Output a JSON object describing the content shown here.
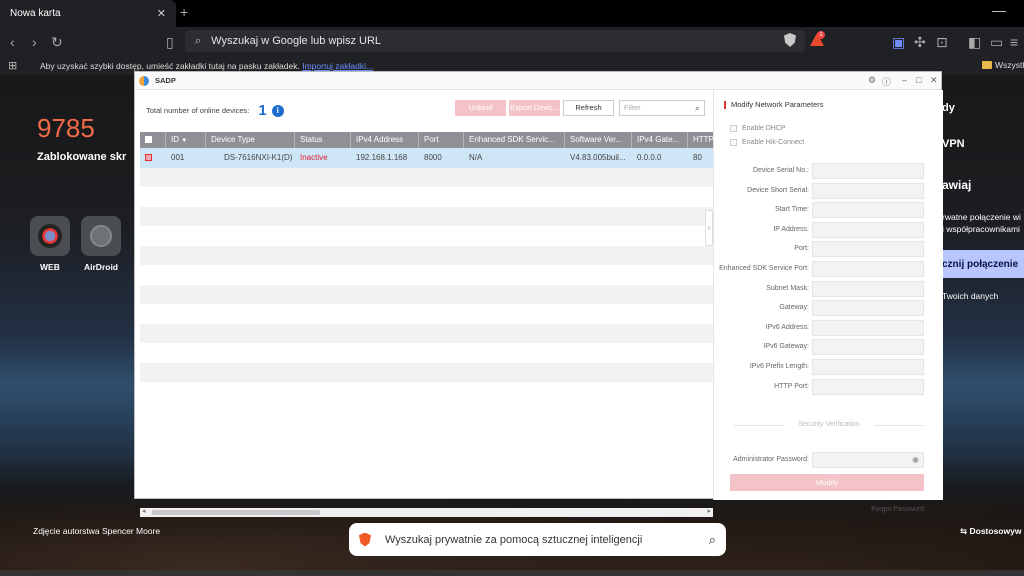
{
  "browser": {
    "tab_title": "Nowa karta",
    "tab_close": "✕",
    "new_tab": "+",
    "address_placeholder": "Wyszukaj w Google lub wpisz URL",
    "brave_badge": "1",
    "bookmarks_hint": "Aby uzyskać szybki dostęp, umieść zakładki tutaj na pasku zakładek.",
    "bookmarks_import": "Importuj zakładki...",
    "bookmarks_folder": "Wszystk"
  },
  "newtab": {
    "counter": "9785",
    "counter_label": "Zablokowane skr",
    "shortcuts": [
      {
        "label": "WEB"
      },
      {
        "label": "AirDroid"
      }
    ],
    "right_fragments": {
      "dy": "dy",
      "vpn": "VPN",
      "awiaj": "awiaj",
      "line1": "rwatne połączenie wi",
      "line2": "i współpracownikami",
      "connect": "cznij połączenie",
      "data": "Twoich danych"
    },
    "photo_credit": "Zdjęcie autorstwa Spencer Moore",
    "customize": "Dostosowyw",
    "ai_search_placeholder": "Wyszukaj prywatnie za pomocą sztucznej inteligencji"
  },
  "sadp": {
    "title": "SADP",
    "online_label": "Total number of online devices:",
    "online_count": "1",
    "buttons": {
      "unbind": "Unbind",
      "export": "Export Devic...",
      "refresh": "Refresh"
    },
    "filter_placeholder": "Filter",
    "columns": [
      "ID",
      "Device Type",
      "Status",
      "IPv4 Address",
      "Port",
      "Enhanced SDK Servic...",
      "Software Ver...",
      "IPv4 Gate...",
      "HTTP"
    ],
    "devices": [
      {
        "id": "001",
        "device_type": "DS-7616NXI-K1(D)",
        "status": "Inactive",
        "ipv4": "192.168.1.168",
        "port": "8000",
        "sdk": "N/A",
        "software": "V4.83.005buil...",
        "gateway": "0.0.0.0",
        "http": "80"
      }
    ],
    "empty_rows": 12,
    "modify": {
      "title": "Modify Network Parameters",
      "enable_dhcp": "Enable DHCP",
      "enable_hik": "Enable Hik-Connect",
      "fields": [
        "Device Serial No.:",
        "Device Short Serial:",
        "Start Time:",
        "IP Address:",
        "Port:",
        "Enhanced SDK Service Port:",
        "Subnet Mask:",
        "Gateway:",
        "IPv6 Address:",
        "IPv6 Gateway:",
        "IPv6 Prefix Length:",
        "HTTP Port:"
      ],
      "security_verification": "Security Verification",
      "admin_password": "Administrator Password:",
      "modify_button": "Modify",
      "forgot_password": "Forgot Password"
    }
  },
  "colors": {
    "accent_blue": "#1f6cd0",
    "inactive_red": "#dd2233",
    "disabled_button": "#f4c3c9",
    "selected_row": "#cfe6f7",
    "header_gray": "#8e9096",
    "counter_orange": "#f06a4a"
  }
}
